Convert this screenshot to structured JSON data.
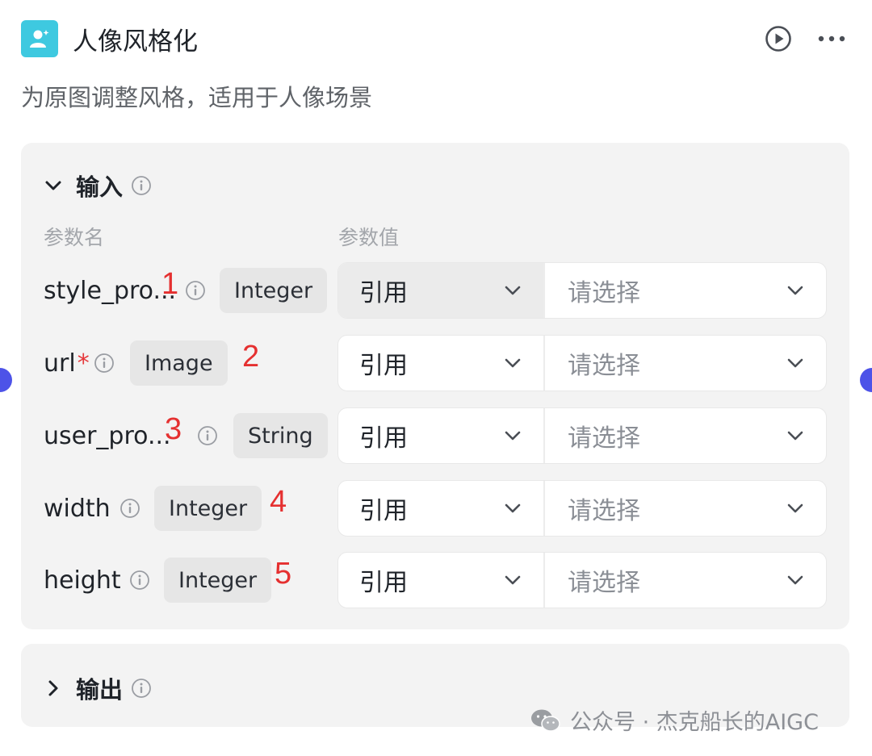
{
  "node": {
    "title": "人像风格化",
    "description": "为原图调整风格，适用于人像场景"
  },
  "input_section": {
    "title": "输入",
    "col_name": "参数名",
    "col_value": "参数值",
    "params": [
      {
        "name": "style_pro...",
        "required": "",
        "type": "Integer",
        "mark": "1",
        "ref": "引用",
        "placeholder": "请选择"
      },
      {
        "name": "url",
        "required": "*",
        "type": "Image",
        "mark": "2",
        "ref": "引用",
        "placeholder": "请选择"
      },
      {
        "name": "user_pro...",
        "required": "",
        "type": "String",
        "mark": "3",
        "ref": "引用",
        "placeholder": "请选择"
      },
      {
        "name": "width",
        "required": "",
        "type": "Integer",
        "mark": "4",
        "ref": "引用",
        "placeholder": "请选择"
      },
      {
        "name": "height",
        "required": "",
        "type": "Integer",
        "mark": "5",
        "ref": "引用",
        "placeholder": "请选择"
      }
    ]
  },
  "output_section": {
    "title": "输出"
  },
  "watermark": {
    "text": "公众号 · 杰克船长的AIGC"
  },
  "colors": {
    "icon_bg": "#3ec9e0",
    "port": "#4d53e8",
    "mark": "#e53030",
    "required": "#e5383b"
  }
}
